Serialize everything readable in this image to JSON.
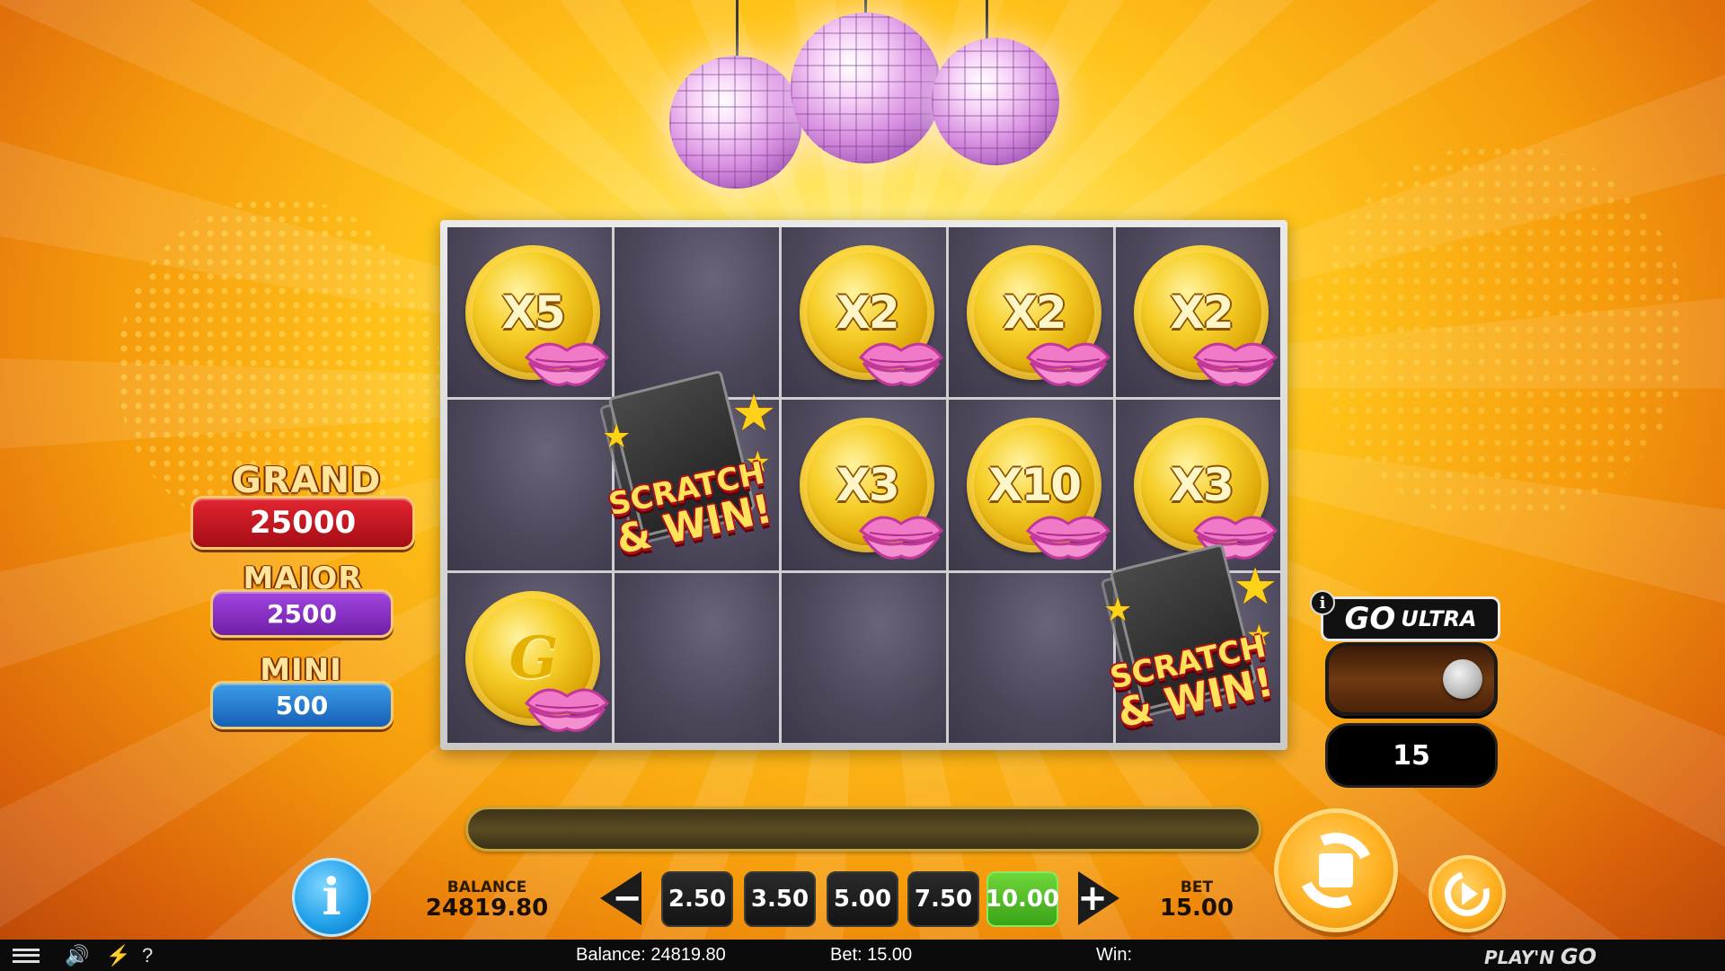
{
  "jackpots": [
    {
      "name": "GRAND",
      "value": "25000",
      "color": "#c8121e"
    },
    {
      "name": "MAJOR",
      "value": "2500",
      "color": "#8a2bc8"
    },
    {
      "name": "MINI",
      "value": "500",
      "color": "#1f7fd6"
    }
  ],
  "grid": {
    "rows": [
      [
        {
          "type": "coin",
          "label": "X5"
        },
        {
          "type": "empty"
        },
        {
          "type": "coin",
          "label": "X2"
        },
        {
          "type": "coin",
          "label": "X2"
        },
        {
          "type": "coin",
          "label": "X2"
        }
      ],
      [
        {
          "type": "empty"
        },
        {
          "type": "scratch"
        },
        {
          "type": "coin",
          "label": "X3"
        },
        {
          "type": "coin",
          "label": "X10"
        },
        {
          "type": "coin",
          "label": "X3"
        }
      ],
      [
        {
          "type": "coin",
          "label": "G"
        },
        {
          "type": "empty"
        },
        {
          "type": "empty"
        },
        {
          "type": "empty"
        },
        {
          "type": "scratch"
        }
      ]
    ],
    "scratch_text": {
      "line1": "SCRATCH",
      "line2": "& WIN!"
    }
  },
  "go_ultra": {
    "info_icon": "info-icon",
    "label_go": "GO",
    "label_ultra": "ULTRA",
    "toggle_state": "off",
    "count": "15"
  },
  "controls": {
    "info_label": "i",
    "balance_label": "BALANCE",
    "balance_value": "24819.80",
    "decrease_label": "−",
    "increase_label": "+",
    "bet_options": [
      "2.50",
      "3.50",
      "5.00",
      "7.50",
      "10.00"
    ],
    "selected_bet": "10.00",
    "bet_label": "BET",
    "bet_value": "15.00",
    "spin_icon": "spin-icon",
    "autoplay_icon": "autoplay-icon"
  },
  "bottom_bar": {
    "balance_text": "Balance: 24819.80",
    "bet_text": "Bet: 15.00",
    "win_text": "Win:",
    "sound_icon": "speaker-icon",
    "turbo_icon": "lightning-icon",
    "help_label": "?",
    "logo_small": "PLAY'N",
    "logo_big": "GO"
  },
  "colors": {
    "accent_gold": "#f7cf2a",
    "active_bet": "#3aa318",
    "info_blue": "#1f9ee8"
  }
}
